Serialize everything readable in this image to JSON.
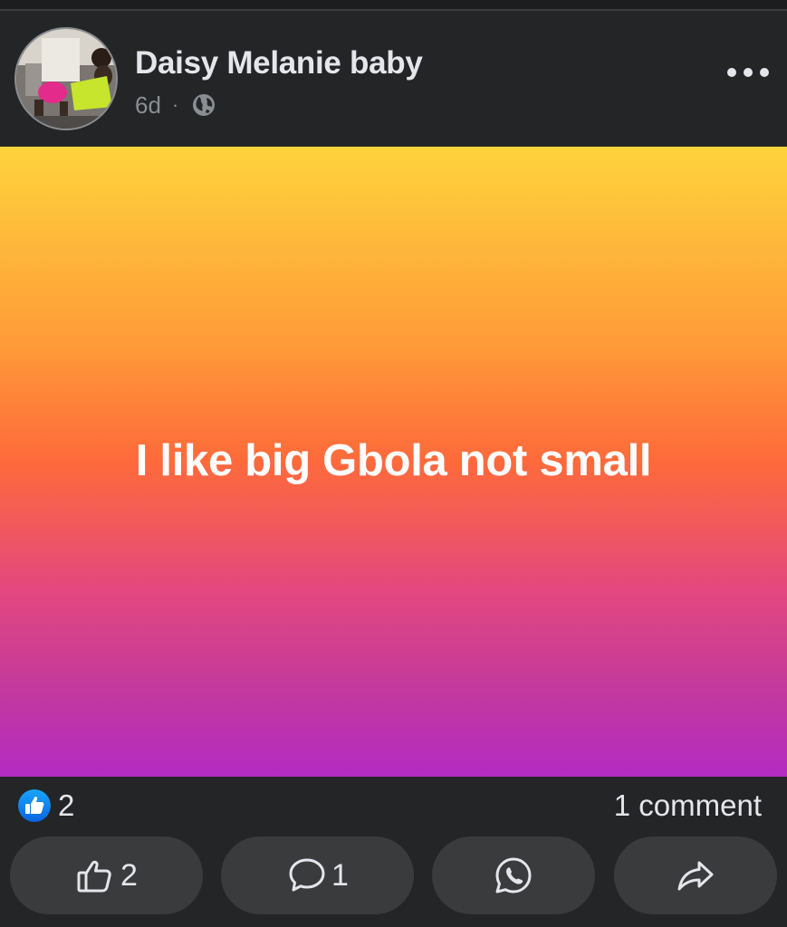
{
  "post": {
    "author": "Daisy Melanie baby",
    "time": "6d",
    "separator": "·",
    "privacy_icon": "globe-icon",
    "menu_icon": "more-dots-icon",
    "text": "I like big Gbola not small",
    "background_gradient": [
      "#fed33c",
      "#ff9e38",
      "#fe6a3b",
      "#e4487e",
      "#c53a9a",
      "#b32bc2"
    ]
  },
  "stats": {
    "reaction_icon": "like-reaction-icon",
    "reaction_count": "2",
    "comment_count": "1 comment"
  },
  "actions": {
    "like": {
      "icon": "thumbs-up-icon",
      "count": "2"
    },
    "comment": {
      "icon": "comment-bubble-icon",
      "count": "1"
    },
    "whatsapp": {
      "icon": "whatsapp-icon"
    },
    "share": {
      "icon": "share-arrow-icon"
    }
  },
  "colors": {
    "background": "#242526",
    "button": "#3a3b3c",
    "text": "#e4e6eb",
    "secondary_text": "#8a8d91",
    "like_blue": "#1877f2"
  }
}
